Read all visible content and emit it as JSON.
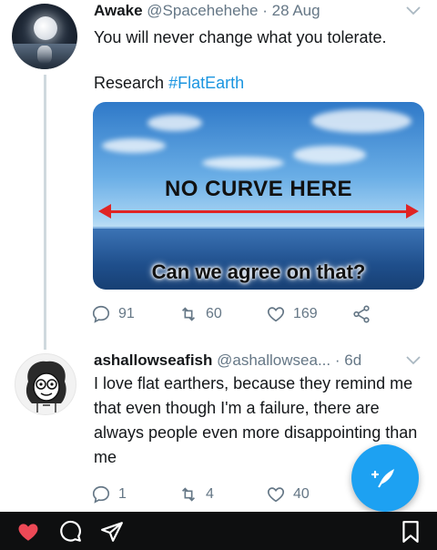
{
  "tweet1": {
    "name": "Awake",
    "handle": "@Spacehehehe",
    "separator": "·",
    "date": "28 Aug",
    "text": "You will never change what you tolerate.",
    "research_text": "Research",
    "hashtag": "#FlatEarth",
    "image": {
      "title": "NO CURVE HERE",
      "bottom_text": "Can we agree on that?"
    },
    "replies": "91",
    "retweets": "60",
    "likes": "169"
  },
  "tweet2": {
    "name": "ashallowseafish",
    "handle": "@ashallowsea...",
    "separator": "·",
    "date": "6d",
    "text": "I love flat earthers, because they remind me that even though I'm a failure, there are always people even more disappointing than me",
    "replies": "1",
    "retweets": "4",
    "likes": "40"
  },
  "icons": {
    "caret": "chevron-down-icon",
    "reply": "reply-icon",
    "retweet": "retweet-icon",
    "like": "heart-icon",
    "share": "share-icon",
    "compose": "compose-tweet-icon",
    "nav_like": "heart-filled-icon",
    "nav_comment": "comment-icon",
    "nav_send": "send-icon",
    "nav_save": "bookmark-icon"
  },
  "colors": {
    "accent": "#1da1f2",
    "hashtag": "#1b95e0",
    "muted": "#657786",
    "like_red": "#ed4956",
    "arrow_red": "#e02424"
  }
}
